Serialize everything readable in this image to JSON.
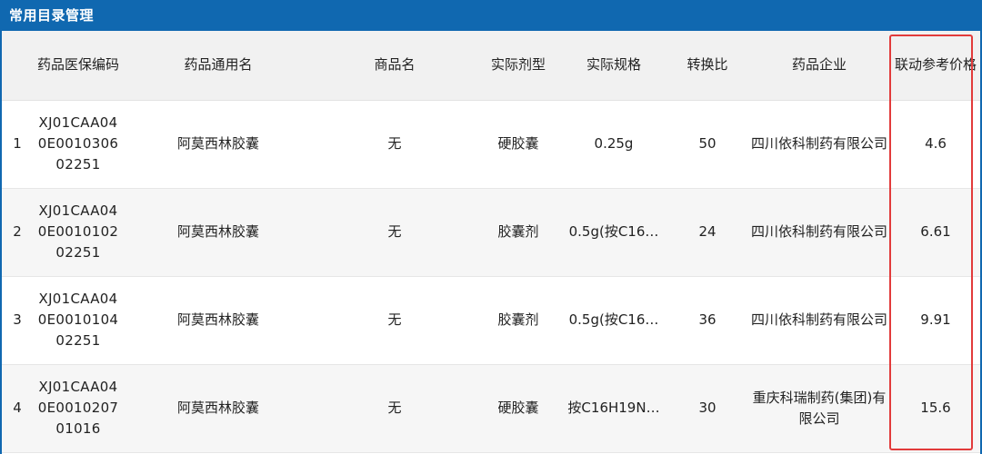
{
  "panel": {
    "title": "常用目录管理"
  },
  "table": {
    "columns": [
      "",
      "药品医保编码",
      "药品通用名",
      "商品名",
      "实际剂型",
      "实际规格",
      "转换比",
      "药品企业",
      "联动参考价格"
    ],
    "rows": [
      {
        "index": "1",
        "code": "XJ01CAA040E001030602251",
        "generic_name": "阿莫西林胶囊",
        "trade_name": "无",
        "dosage_form": "硬胶囊",
        "spec": "0.25g",
        "ratio": "50",
        "company": "四川依科制药有限公司",
        "price": "4.6"
      },
      {
        "index": "2",
        "code": "XJ01CAA040E001010202251",
        "generic_name": "阿莫西林胶囊",
        "trade_name": "无",
        "dosage_form": "胶囊剂",
        "spec": "0.5g(按C16…",
        "ratio": "24",
        "company": "四川依科制药有限公司",
        "price": "6.61"
      },
      {
        "index": "3",
        "code": "XJ01CAA040E001010402251",
        "generic_name": "阿莫西林胶囊",
        "trade_name": "无",
        "dosage_form": "胶囊剂",
        "spec": "0.5g(按C16…",
        "ratio": "36",
        "company": "四川依科制药有限公司",
        "price": "9.91"
      },
      {
        "index": "4",
        "code": "XJ01CAA040E001020701016",
        "generic_name": "阿莫西林胶囊",
        "trade_name": "无",
        "dosage_form": "硬胶囊",
        "spec": "按C16H19N…",
        "ratio": "30",
        "company": "重庆科瑞制药(集团)有限公司",
        "price": "15.6"
      }
    ]
  },
  "colors": {
    "header_blue": "#1068b0",
    "highlight_red": "#e23b3b"
  }
}
